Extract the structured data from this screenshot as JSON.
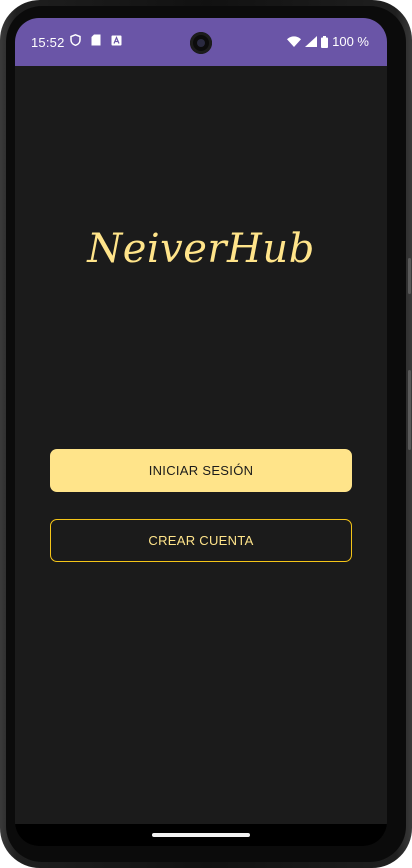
{
  "status_bar": {
    "time": "15:52",
    "battery_percent": "100 %",
    "background_color": "#6a55a7",
    "left_icons": [
      "shield-icon",
      "sd-card-icon",
      "keyboard-a-icon"
    ],
    "right_icons": [
      "wifi-icon",
      "signal-icon",
      "battery-icon"
    ]
  },
  "app": {
    "logo_text": "NeiverHub",
    "logo_color": "#ffe48a",
    "background_color": "#1b1b1b"
  },
  "buttons": {
    "login_label": "INICIAR SESIÓN",
    "signup_label": "CREAR CUENTA"
  },
  "accent_colors": {
    "primary_fill": "#ffe48a",
    "outline_border": "#f5c518"
  }
}
